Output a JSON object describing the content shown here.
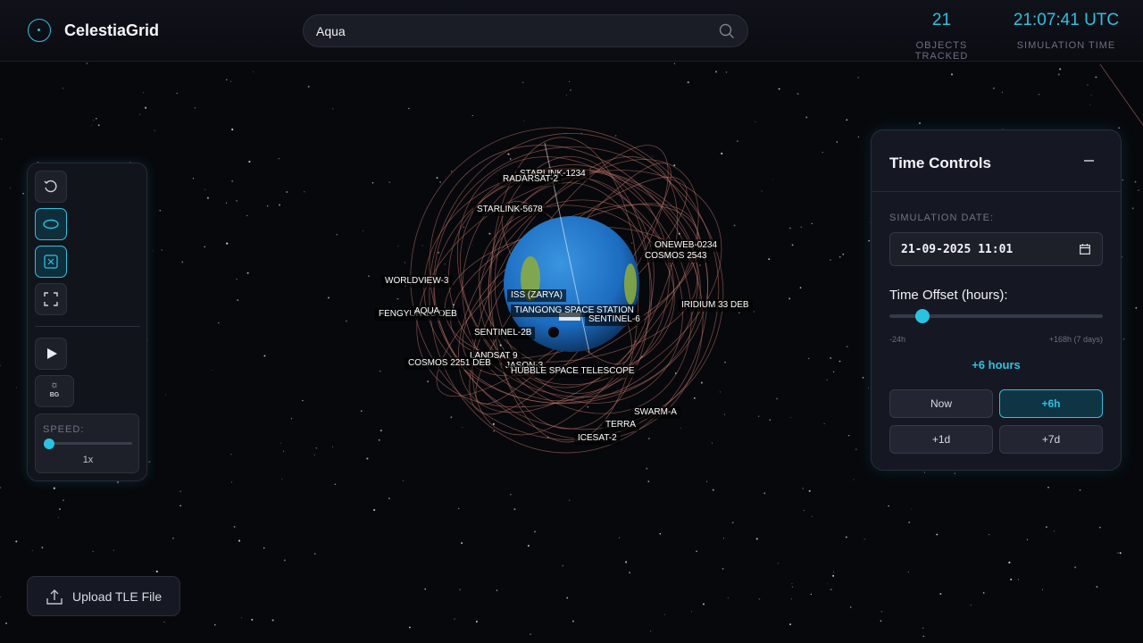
{
  "app": {
    "title": "CelestiaGrid"
  },
  "search": {
    "value": "Aqua",
    "icon": "search-icon"
  },
  "stats": {
    "objects_tracked": {
      "value": "21",
      "label": "OBJECTS TRACKED"
    },
    "simulation_time": {
      "value": "21:07:41 UTC",
      "label": "SIMULATION TIME"
    }
  },
  "toolbar": {
    "icons": [
      "reset-view-icon",
      "orbit-toggle-icon",
      "close-box-icon",
      "fullscreen-icon",
      "play-icon",
      "background-toggle-icon"
    ],
    "bg_label": "BG",
    "speed": {
      "label": "SPEED:",
      "value": "1x"
    }
  },
  "satellites": [
    "STARLINK-1234",
    "RADARSAT-2",
    "STARLINK-5678",
    "ONEWEB-0234",
    "COSMOS 2543",
    "WORLDVIEW-3",
    "ISS (ZARYA)",
    "IRIDIUM 33 DEB",
    "FENGYUN 1C DEB",
    "AQUA",
    "TIANGONG SPACE STATION",
    "SENTINEL-6",
    "SENTINEL-2B",
    "LANDSAT 9",
    "COSMOS 2251 DEB",
    "JASON-3",
    "HUBBLE SPACE TELESCOPE",
    "SWARM-A",
    "TERRA",
    "ICESAT-2"
  ],
  "upload": {
    "label": "Upload TLE File",
    "icon": "upload-icon"
  },
  "time_controls": {
    "title": "Time Controls",
    "date_label": "SIMULATION DATE:",
    "date_value": "21-09-2025 11:01",
    "offset_label": "Time Offset (hours):",
    "offset_value": 6,
    "offset_min": -24,
    "offset_max": 168,
    "min_label": "-24h",
    "max_label": "+168h (7 days)",
    "offset_display": "+6 hours",
    "buttons": [
      "Now",
      "+6h",
      "+1d",
      "+7d"
    ],
    "active_button": "+6h"
  },
  "colors": {
    "accent": "#29c2e0",
    "orbit": "#c87a6e",
    "earth_ocean": "#1e73c8",
    "earth_land": "#8fae3a"
  }
}
